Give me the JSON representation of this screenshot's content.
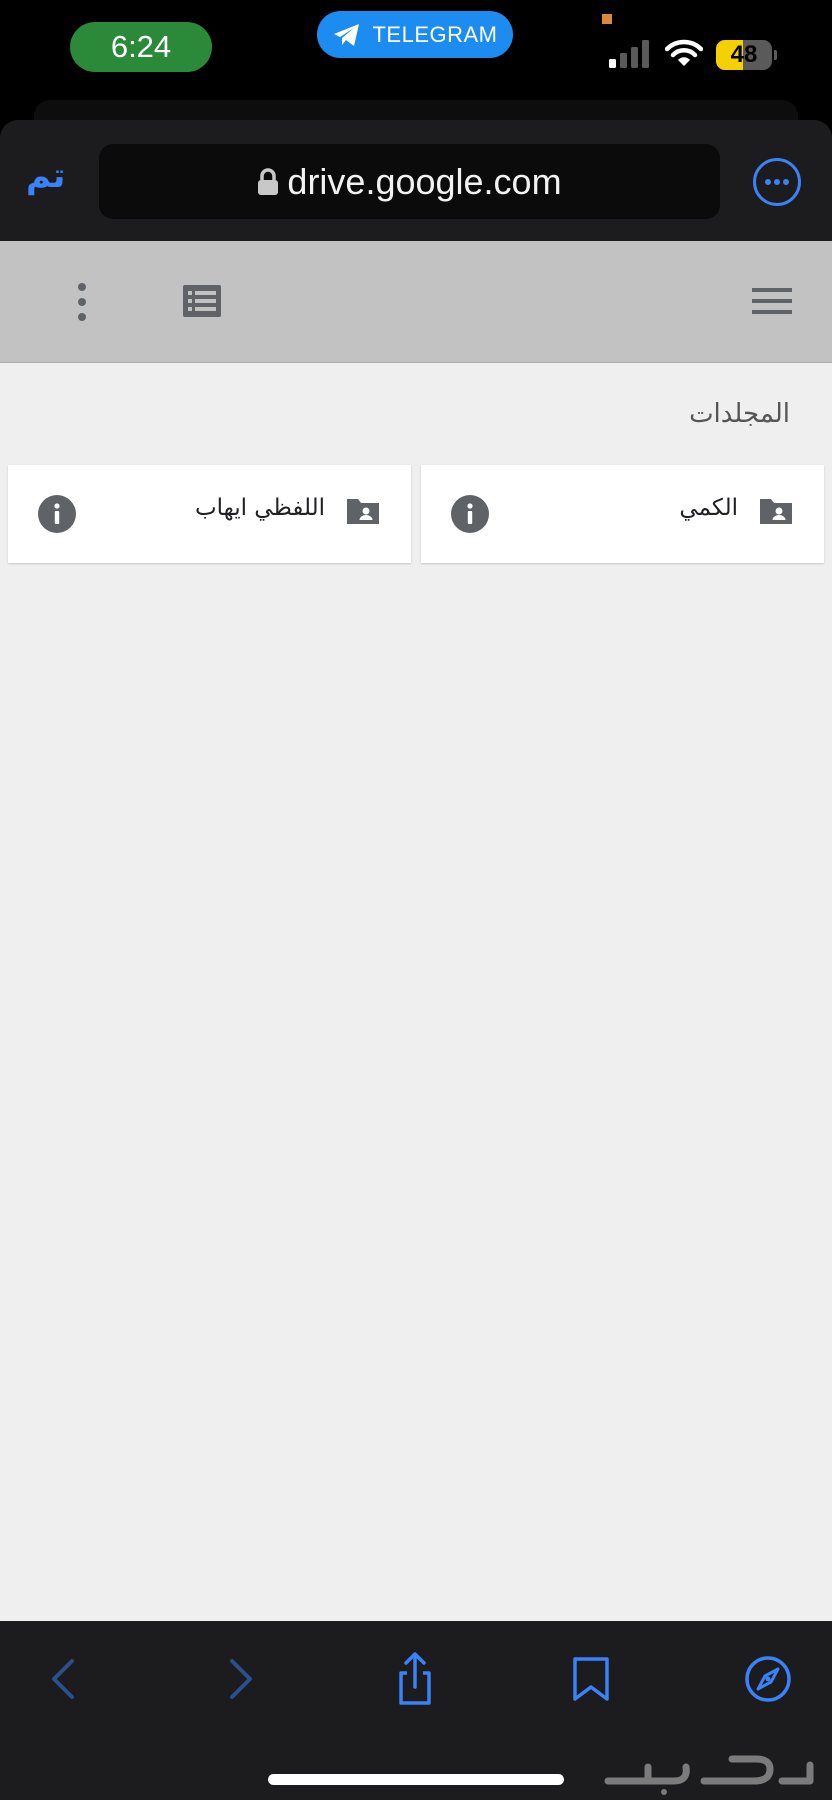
{
  "status_bar": {
    "time": "6:24",
    "app_pill": "TELEGRAM",
    "battery_level": "48",
    "battery_fraction": 0.48,
    "colors": {
      "time_pill": "#2a8a3a",
      "app_pill": "#1d8cf0",
      "battery": "#f5d000"
    }
  },
  "browser": {
    "done_label": "تم",
    "url": "drive.google.com",
    "icons": [
      "lock-icon",
      "more-icon"
    ],
    "accent_color": "#3a82f7"
  },
  "drive": {
    "toolbar_icons": [
      "kebab-menu-icon",
      "list-view-icon",
      "hamburger-menu-icon"
    ],
    "section_title": "المجلدات",
    "folders": [
      {
        "name": "الكمي",
        "icon": "shared-folder-icon"
      },
      {
        "name": "اللفظي ايهاب",
        "icon": "shared-folder-icon"
      }
    ]
  },
  "bottom_toolbar": {
    "icons": [
      "back-arrow-icon",
      "forward-arrow-icon",
      "share-icon",
      "bookmarks-icon",
      "compass-icon"
    ],
    "watermark_icon": "haraj-watermark"
  }
}
